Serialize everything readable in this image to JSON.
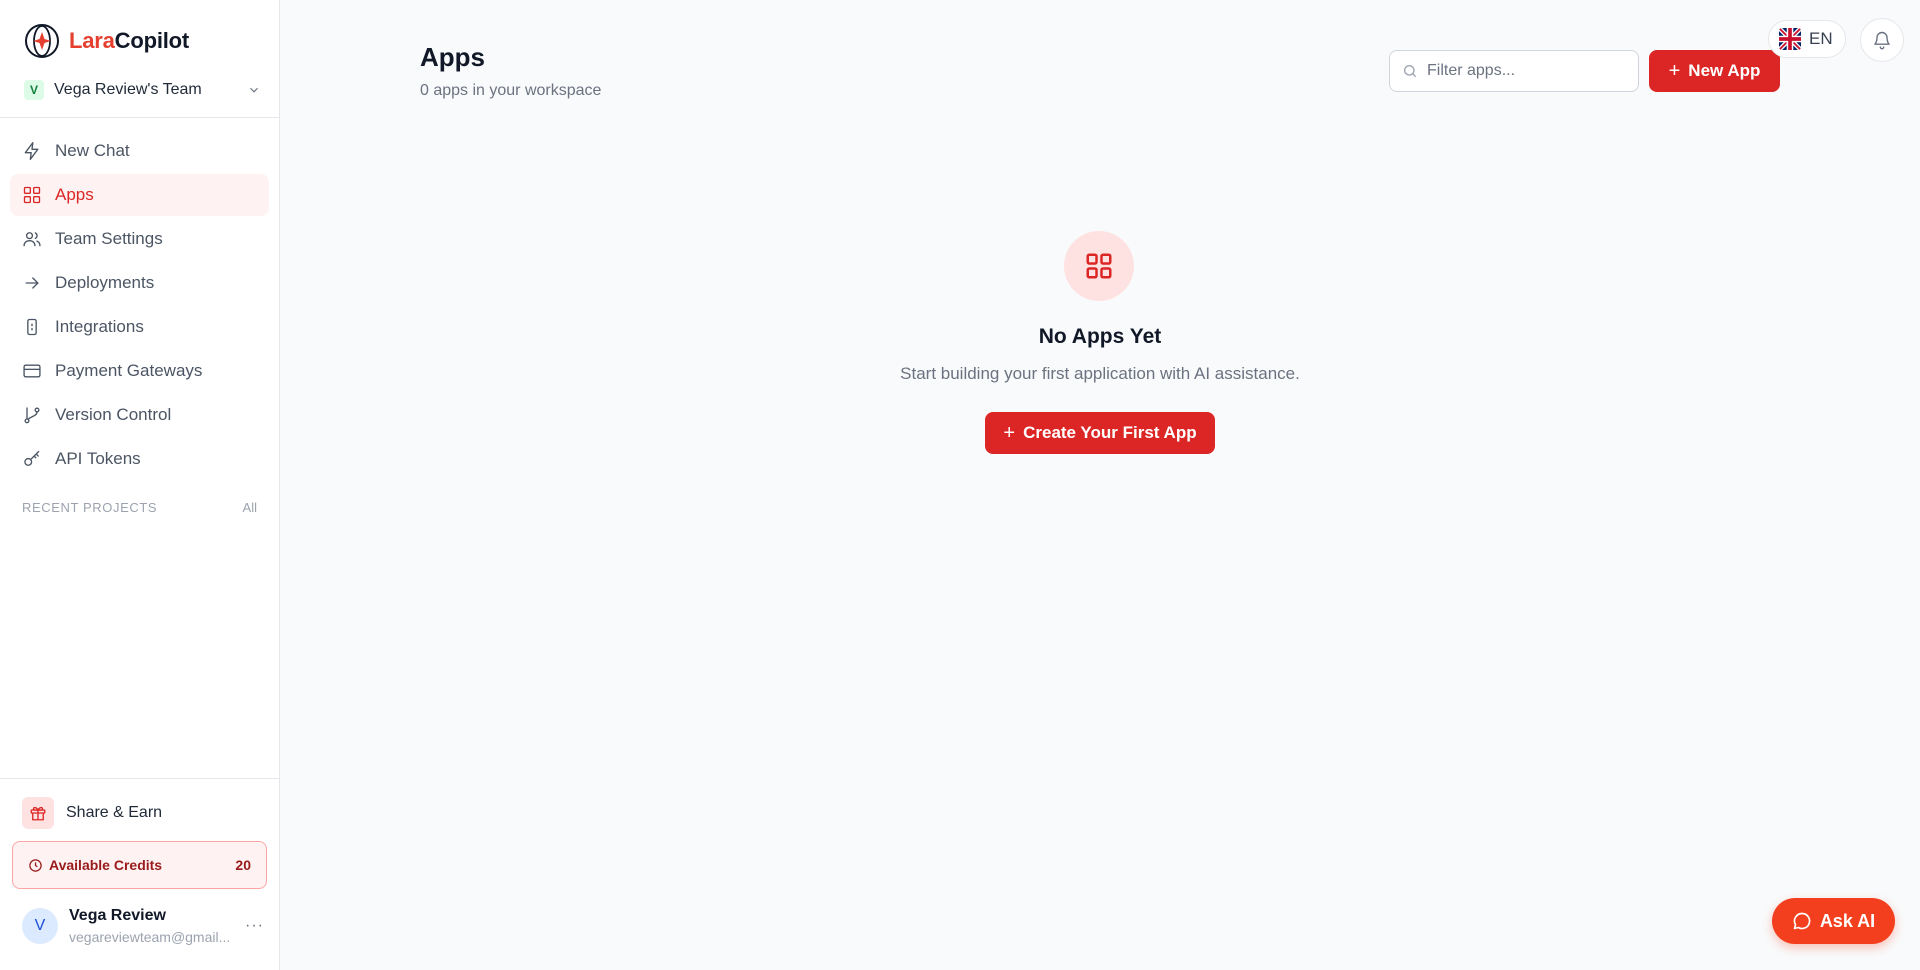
{
  "brand": {
    "name_part1": "Lara",
    "name_part2": "Copilot",
    "color": "#e5402f"
  },
  "team": {
    "badge": "V",
    "name": "Vega Review's Team"
  },
  "nav": {
    "items": [
      {
        "label": "New Chat",
        "icon": "bolt-icon"
      },
      {
        "label": "Apps",
        "icon": "grid-icon",
        "active": true
      },
      {
        "label": "Team Settings",
        "icon": "users-icon"
      },
      {
        "label": "Deployments",
        "icon": "arrow-right-icon"
      },
      {
        "label": "Integrations",
        "icon": "plug-icon"
      },
      {
        "label": "Payment Gateways",
        "icon": "credit-card-icon"
      },
      {
        "label": "Version Control",
        "icon": "git-branch-icon"
      },
      {
        "label": "API Tokens",
        "icon": "key-icon"
      }
    ]
  },
  "recent": {
    "heading": "RECENT PROJECTS",
    "all_link": "All"
  },
  "share": {
    "label": "Share & Earn"
  },
  "credits": {
    "label": "Available Credits",
    "value": "20"
  },
  "user": {
    "initial": "V",
    "name": "Vega Review",
    "email": "vegareviewteam@gmail...",
    "more": "···"
  },
  "header": {
    "title": "Apps",
    "subtitle": "0 apps in your workspace",
    "filter_placeholder": "Filter apps...",
    "new_app": "New App",
    "language": "EN"
  },
  "empty": {
    "title": "No Apps Yet",
    "subtitle": "Start building your first application with AI assistance.",
    "cta": "Create Your First App"
  },
  "ask_ai": "Ask AI",
  "colors": {
    "accent": "#dc2626",
    "accent_soft": "#fef2f2"
  }
}
